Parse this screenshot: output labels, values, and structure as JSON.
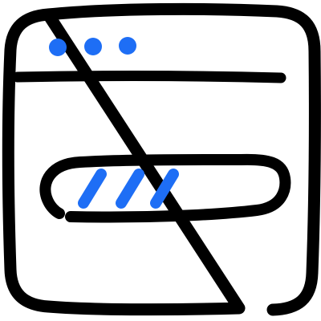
{
  "illustration": {
    "icon": "browser-window-loading-icon",
    "style": "hand-drawn line art",
    "colors": {
      "stroke": "#000000",
      "accent": "#1E6EF5",
      "background": "#FFFFFF"
    },
    "window_control_dots": 3,
    "progress_stripes": 3
  }
}
